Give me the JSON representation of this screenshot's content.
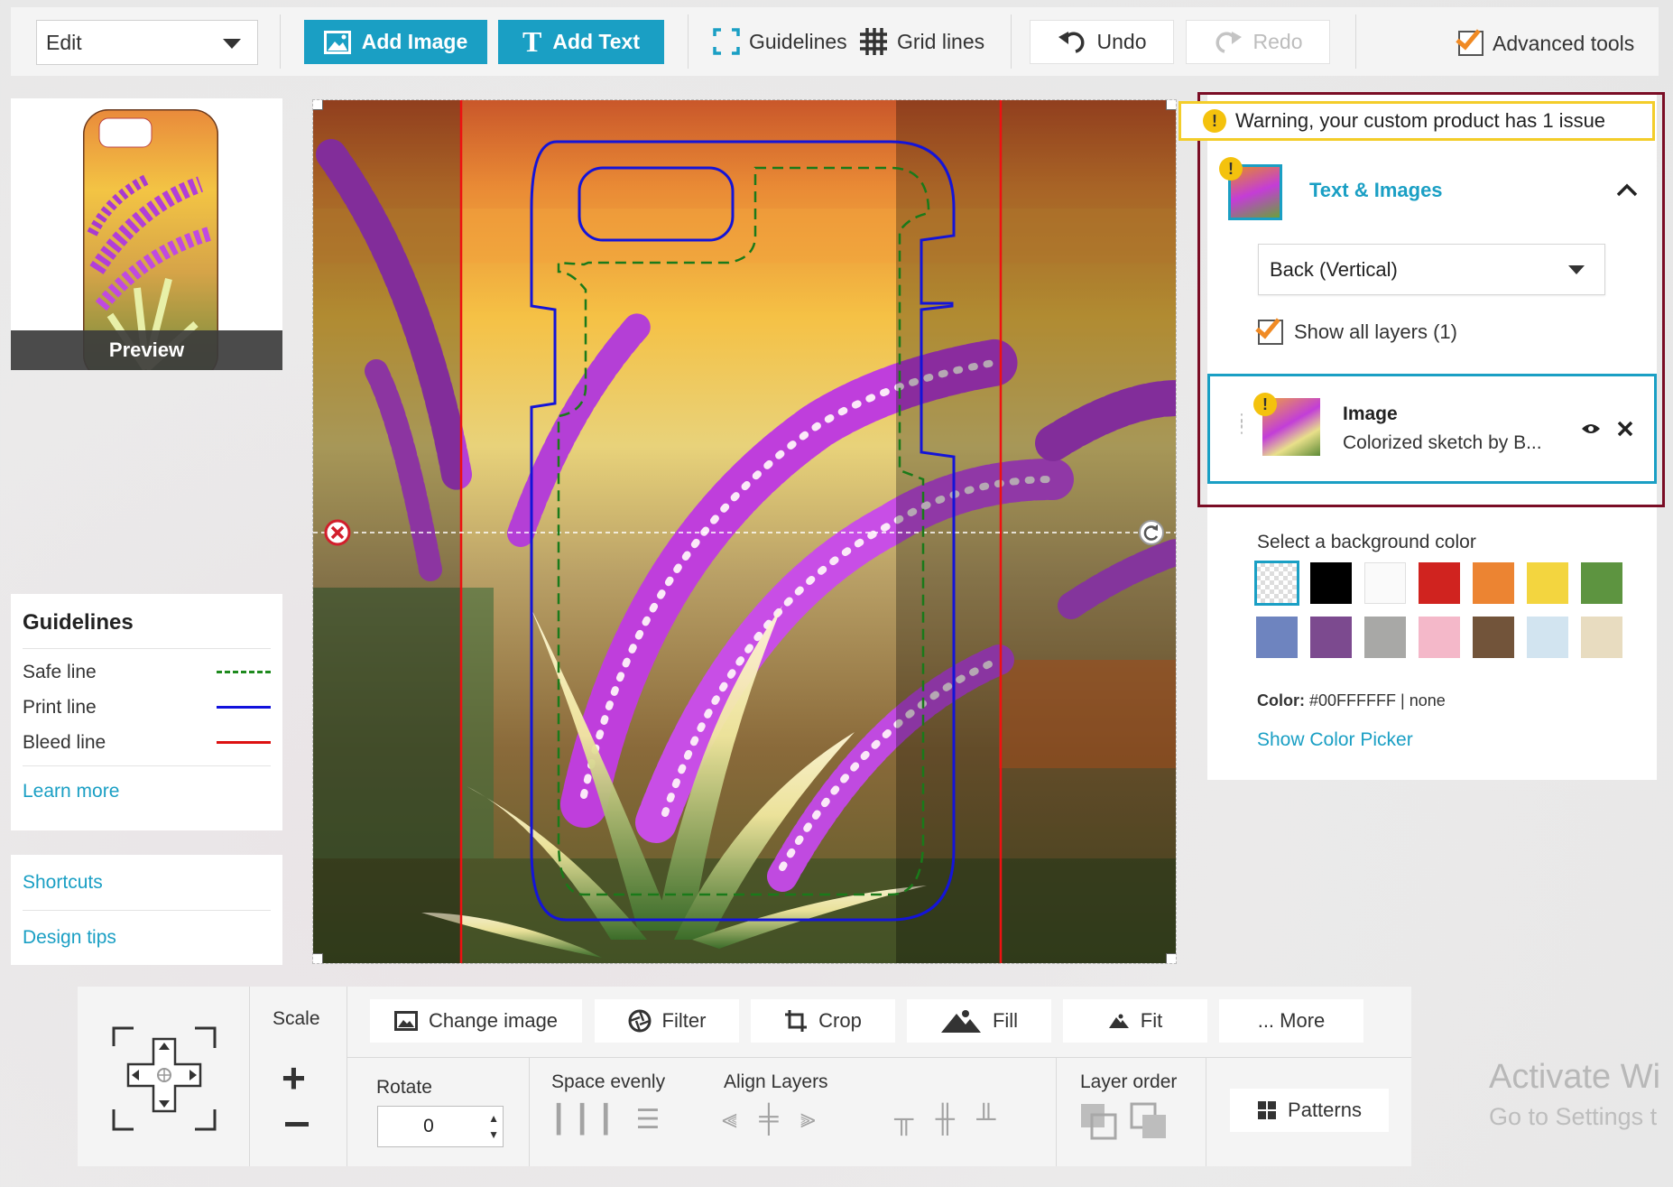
{
  "toolbar": {
    "mode_select": "Edit",
    "add_image": "Add Image",
    "add_text": "Add Text",
    "guidelines": "Guidelines",
    "grid_lines": "Grid lines",
    "undo": "Undo",
    "redo": "Redo",
    "advanced_tools": "Advanced tools",
    "advanced_tools_checked": true
  },
  "preview": {
    "label": "Preview"
  },
  "guidelines_card": {
    "title": "Guidelines",
    "items": [
      {
        "label": "Safe line",
        "color": "#1e8a1e",
        "style": "dashed"
      },
      {
        "label": "Print line",
        "color": "#1111dd",
        "style": "solid"
      },
      {
        "label": "Bleed line",
        "color": "#dd1111",
        "style": "solid"
      }
    ],
    "learn_more": "Learn more"
  },
  "links_card": {
    "shortcuts": "Shortcuts",
    "design_tips": "Design tips"
  },
  "right_panel": {
    "warning": "Warning, your custom product has 1 issue",
    "section_title": "Text & Images",
    "side_select": "Back (Vertical)",
    "show_all_layers": "Show all layers (1)",
    "layer": {
      "title": "Image",
      "subtitle": "Colorized sketch by B..."
    },
    "background_label": "Select a background color",
    "swatches": [
      "transparent",
      "#000000",
      "#fafafa",
      "#d0231f",
      "#ec8432",
      "#f3d53f",
      "#5d9440",
      "#6e84bf",
      "#7c4a8f",
      "#a8a8a6",
      "#f4b8c9",
      "#72543a",
      "#d2e4f0",
      "#e8dcc0"
    ],
    "color_label": "Color:",
    "color_value": "#00FFFFFF | none",
    "show_color_picker": "Show Color Picker"
  },
  "bottom": {
    "scale": "Scale",
    "change_image": "Change image",
    "filter": "Filter",
    "crop": "Crop",
    "fill": "Fill",
    "fit": "Fit",
    "more": "... More",
    "rotate_label": "Rotate",
    "rotate_value": "0",
    "space_evenly": "Space evenly",
    "align_layers": "Align Layers",
    "layer_order": "Layer order",
    "patterns": "Patterns"
  },
  "watermark": {
    "line1": "Activate Wi",
    "line2": "Go to Settings t"
  }
}
